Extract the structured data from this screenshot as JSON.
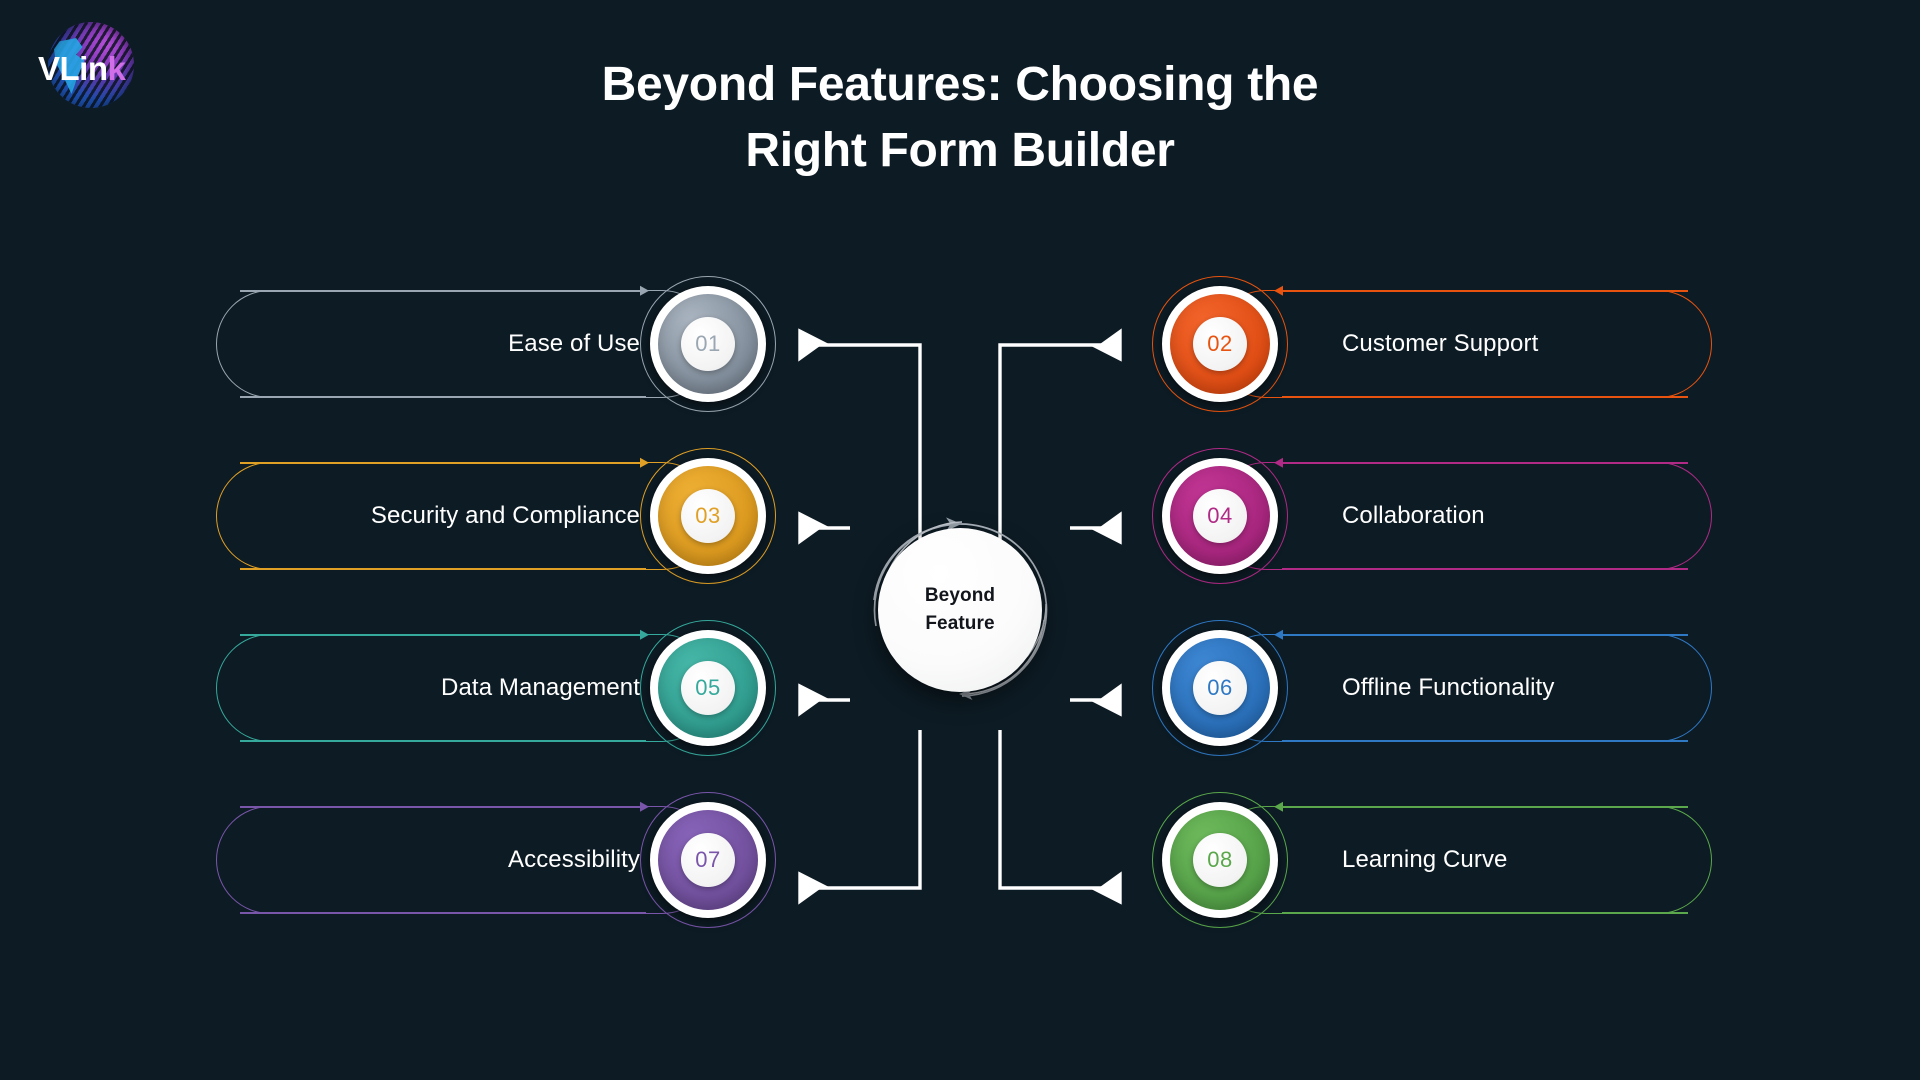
{
  "logo": {
    "name_v": "V",
    "name_link": "Lin",
    "name_k": "k",
    "icon": "globe-icon"
  },
  "header": {
    "title_line1": "Beyond Features: Choosing the",
    "title_line2": "Right Form Builder"
  },
  "center": {
    "line1": "Beyond",
    "line2": "Feature"
  },
  "colors": {
    "background": "#0d1b24",
    "text": "#ffffff",
    "connector": "#ffffff",
    "hub_text": "#12161c"
  },
  "items": [
    {
      "number": "01",
      "label": "Ease of Use",
      "side": "left",
      "color": "#9aa6b2",
      "grad_from": "#a9b4c0",
      "grad_to": "#6d7a88"
    },
    {
      "number": "02",
      "label": "Customer Support",
      "side": "right",
      "color": "#e8540f",
      "grad_from": "#f1632a",
      "grad_to": "#d8430a"
    },
    {
      "number": "03",
      "label": "Security and Compliance",
      "side": "left",
      "color": "#e0a025",
      "grad_from": "#edae34",
      "grad_to": "#d28f14"
    },
    {
      "number": "04",
      "label": "Collaboration",
      "side": "right",
      "color": "#b02a86",
      "grad_from": "#bf3492",
      "grad_to": "#9c1f74"
    },
    {
      "number": "05",
      "label": "Data Management",
      "side": "left",
      "color": "#35a99b",
      "grad_from": "#45b6a7",
      "grad_to": "#269184"
    },
    {
      "number": "06",
      "label": "Offline Functionality",
      "side": "right",
      "color": "#2f78c4",
      "grad_from": "#3d86d2",
      "grad_to": "#2064ad"
    },
    {
      "number": "07",
      "label": "Accessibility",
      "side": "left",
      "color": "#7a56ab",
      "grad_from": "#8763b8",
      "grad_to": "#66468f"
    },
    {
      "number": "08",
      "label": "Learning Curve",
      "side": "right",
      "color": "#5aa84b",
      "grad_from": "#6cb85a",
      "grad_to": "#4a9640"
    }
  ]
}
